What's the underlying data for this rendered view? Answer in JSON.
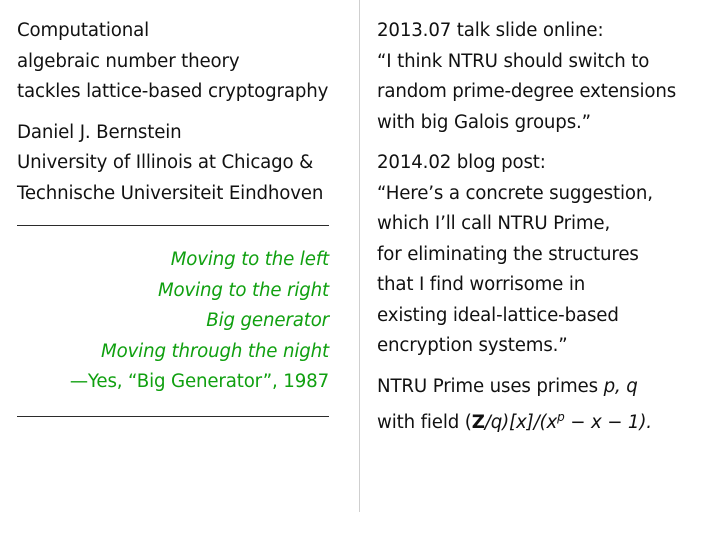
{
  "left": {
    "title_lines": [
      "Computational",
      "algebraic number theory",
      "tackles lattice-based cryptography"
    ],
    "author": "Daniel J. Bernstein",
    "affiliation_lines": [
      "University of Illinois at Chicago &",
      "Technische Universiteit Eindhoven"
    ],
    "quote": {
      "lines": [
        "Moving to the left",
        "Moving to the right",
        "Big generator",
        "Moving through the night"
      ],
      "attribution": "—Yes, “Big Generator”, 1987",
      "color": "#10a010"
    }
  },
  "right": {
    "block1": {
      "heading": "2013.07 talk slide online:",
      "lines": [
        "“I think NTRU should switch to",
        "random prime-degree extensions",
        "with big Galois groups.”"
      ]
    },
    "block2": {
      "heading": "2014.02 blog post:",
      "lines": [
        "“Here’s a concrete suggestion,",
        "which I’ll call NTRU Prime,",
        "for eliminating the structures",
        "that I find worrisome in",
        "existing ideal-lattice-based",
        "encryption systems.”"
      ]
    },
    "block3": {
      "line1_text": "NTRU Prime uses primes ",
      "line1_math": "p, q",
      "line2_text": "with field ",
      "formula": {
        "open": "(",
        "Z": "Z",
        "slash_q": "/q",
        "close_x": ")[x]/(x",
        "exp": "p",
        "tail": " − x − 1)."
      }
    }
  }
}
